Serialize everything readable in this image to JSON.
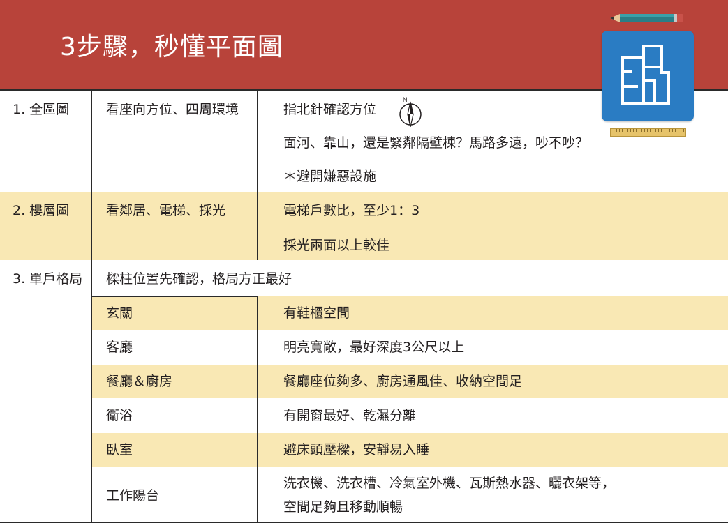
{
  "title": "3步驟，秒懂平面圖",
  "rows": {
    "r1": {
      "section": "1. 全區圖",
      "item": "看座向方位、四周環境",
      "details": [
        "指北針確認方位",
        "面河、靠山，還是緊鄰隔壁棟？馬路多遠，吵不吵？",
        "＊避開嫌惡設施"
      ],
      "compass_letter": "N"
    },
    "r2": {
      "section": "2. 樓層圖",
      "item": "看鄰居、電梯、採光",
      "details": [
        "電梯戶數比，至少1：3",
        "採光兩面以上較佳"
      ]
    },
    "r3": {
      "section": "3. 單戶格局",
      "intro": "樑柱位置先確認，格局方正最好",
      "rooms": [
        {
          "name": "玄關",
          "desc": "有鞋櫃空間"
        },
        {
          "name": "客廳",
          "desc": "明亮寬敞，最好深度3公尺以上"
        },
        {
          "name": "餐廳＆廚房",
          "desc": "餐廳座位夠多、廚房通風佳、收納空間足"
        },
        {
          "name": "衛浴",
          "desc": "有開窗最好、乾濕分離"
        },
        {
          "name": "臥室",
          "desc": "避床頭壓樑，安靜易入睡"
        },
        {
          "name": "工作陽台",
          "desc_lines": [
            "洗衣機、洗衣槽、冷氣室外機、瓦斯熱水器、曬衣架等，",
            "空間足夠且移動順暢"
          ]
        }
      ]
    }
  },
  "colors": {
    "header": "#b8433a",
    "band": "#f9e8b4",
    "icon_bg": "#2a7cc3",
    "text": "#231f20"
  },
  "icons": {
    "pencil": "pencil-icon",
    "floorplan": "floor-plan-icon",
    "ruler": "ruler-icon",
    "compass": "compass-icon"
  }
}
